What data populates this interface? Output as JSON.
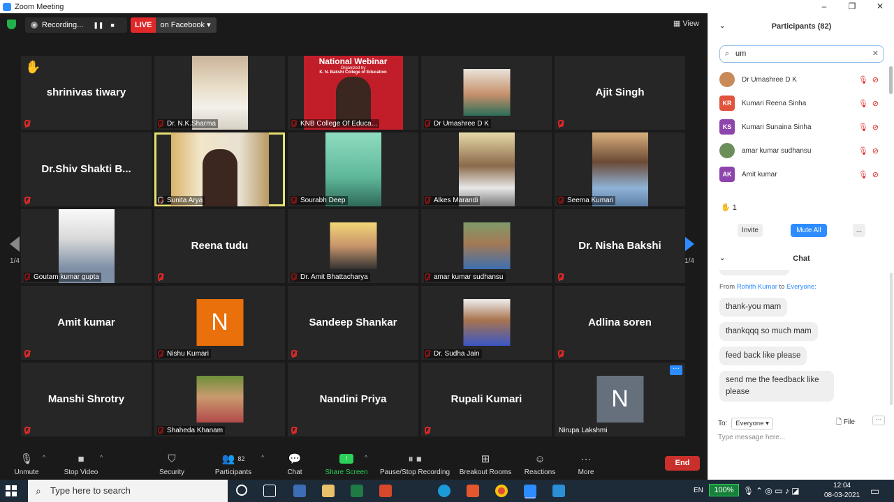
{
  "window": {
    "title": "Zoom Meeting",
    "controls": [
      "–",
      "❐",
      "✕"
    ]
  },
  "topbar": {
    "recording_label": "Recording...",
    "pause_icon": "❚❚",
    "stop_icon": "■",
    "live_label": "LIVE",
    "live_target": "on Facebook ▾",
    "view_label": "View"
  },
  "tiles": [
    {
      "name": "shrinivas tiwary",
      "label": "",
      "hand": "✋"
    },
    {
      "name": "",
      "label": "Dr. N.K.Sharma"
    },
    {
      "name": "",
      "label": "KNB College Of Educa..."
    },
    {
      "name": "",
      "label": "Dr Umashree D K"
    },
    {
      "name": "Ajit Singh",
      "label": ""
    },
    {
      "name": "Dr.Shiv  Shakti  B...",
      "label": ""
    },
    {
      "name": "",
      "label": "Sunita Arya"
    },
    {
      "name": "",
      "label": "Sourabh Deep"
    },
    {
      "name": "",
      "label": "Alkes Marandi"
    },
    {
      "name": "",
      "label": "Seema Kumari"
    },
    {
      "name": "",
      "label": "Goutam kumar gupta"
    },
    {
      "name": "Reena tudu",
      "label": ""
    },
    {
      "name": "",
      "label": "Dr. Amit Bhattacharya"
    },
    {
      "name": "",
      "label": "amar kumar sudhansu"
    },
    {
      "name": "Dr. Nisha Bakshi",
      "label": ""
    },
    {
      "name": "Amit kumar",
      "label": ""
    },
    {
      "name": "",
      "label": "Nishu Kumari",
      "initial": "N"
    },
    {
      "name": "Sandeep Shankar",
      "label": ""
    },
    {
      "name": "",
      "label": "Dr. Sudha Jain"
    },
    {
      "name": "Adlina soren",
      "label": ""
    },
    {
      "name": "Manshi Shrotry",
      "label": ""
    },
    {
      "name": "",
      "label": "Shaheda Khanam"
    },
    {
      "name": "Nandini Priya",
      "label": ""
    },
    {
      "name": "Rupali Kumari",
      "label": ""
    },
    {
      "name": "",
      "label": "Nirupa Lakshmi",
      "initial": "N",
      "dots": "···"
    }
  ],
  "webinar_banner": {
    "title": "National Webinar",
    "sub": "Organized by",
    "college": "K. N. Bakshi College of Education"
  },
  "pager": {
    "left": "1/4",
    "right": "1/4"
  },
  "toolbar": {
    "unmute": "Unmute",
    "stop_video": "Stop Video",
    "security": "Security",
    "participants": "Participants",
    "participants_count": "82",
    "chat": "Chat",
    "share_screen": "Share Screen",
    "recording": "Pause/Stop Recording",
    "breakout": "Breakout Rooms",
    "reactions": "Reactions",
    "more": "More",
    "end": "End"
  },
  "participants_panel": {
    "title": "Participants (82)",
    "search_value": "um",
    "items": [
      {
        "name": "Dr Umashree D K",
        "initials": "",
        "color": "#c98a5a"
      },
      {
        "name": "Kumari Reena Sinha",
        "initials": "KR",
        "color": "#e0533c"
      },
      {
        "name": "Kumari Sunaina Sinha",
        "initials": "KS",
        "color": "#8e44ad"
      },
      {
        "name": "amar kumar sudhansu",
        "initials": "",
        "color": "#6b8e5a"
      },
      {
        "name": "Amit kumar",
        "initials": "AK",
        "color": "#8e44ad"
      }
    ],
    "hand_count": "1",
    "invite": "Invite",
    "mute_all": "Mute All",
    "more": "..."
  },
  "chat_panel": {
    "title": "Chat",
    "from_prefix": "From",
    "from_name": "Rohith Kumar",
    "to_word": "to",
    "to_name": "Everyone:",
    "messages": [
      "thank-you mam",
      "thankqqq so much mam",
      "feed back like please",
      "send me the feedback like please"
    ],
    "to_label": "To:",
    "to_select": "Everyone ▾",
    "file_label": "File",
    "more": "···",
    "placeholder": "Type message here..."
  },
  "taskbar": {
    "search_placeholder": "Type here to search",
    "lang": "EN",
    "battery": "100%",
    "time": "12:04",
    "date": "08-03-2021"
  },
  "colors": {
    "accent": "#2d8cff",
    "live": "#e02828",
    "active_speaker": "#e6e070",
    "share_green": "#2bd158",
    "end": "#c9302c"
  }
}
